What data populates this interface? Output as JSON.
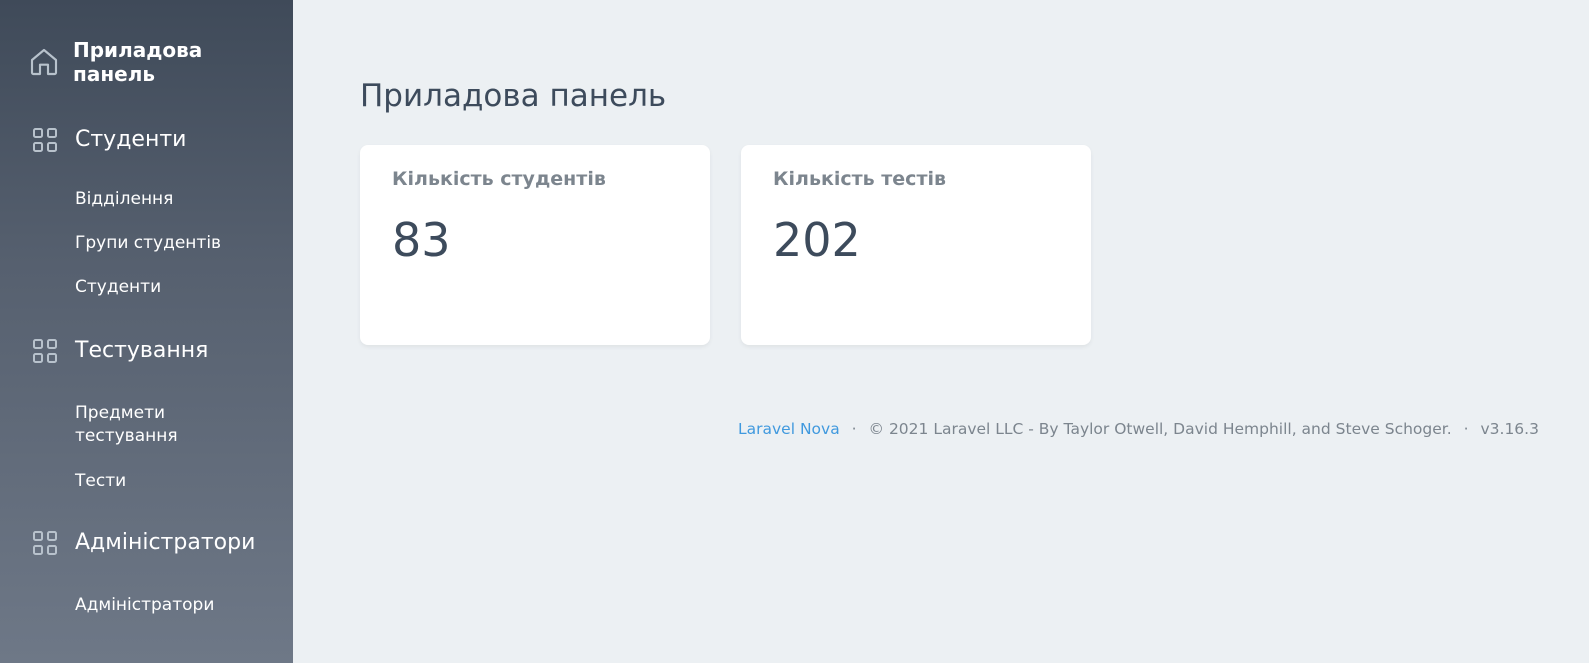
{
  "sidebar": {
    "dashboard": {
      "label": "Приладова панель",
      "icon": "home-icon"
    },
    "groups": [
      {
        "label": "Студенти",
        "icon": "grid-icon",
        "items": [
          "Відділення",
          "Групи студентів",
          "Студенти"
        ]
      },
      {
        "label": "Тестування",
        "icon": "grid-icon",
        "items": [
          "Предмети тестування",
          "Тести"
        ]
      },
      {
        "label": "Адміністратори",
        "icon": "grid-icon",
        "items": [
          "Адміністратори"
        ]
      }
    ]
  },
  "main": {
    "title": "Приладова панель",
    "cards": [
      {
        "title": "Кількість студентів",
        "value": "83"
      },
      {
        "title": "Кількість тестів",
        "value": "202"
      }
    ]
  },
  "footer": {
    "brand": "Laravel Nova",
    "separator": "·",
    "copyright": "© 2021 Laravel LLC - By Taylor Otwell, David Hemphill, and Steve Schoger.",
    "version": "v3.16.3"
  },
  "colors": {
    "sidebar_top": "#3f4a59",
    "sidebar_bottom": "#6e7887",
    "background": "#ecf0f3",
    "link": "#4099de",
    "heading": "#3d4b5c",
    "muted": "#7c858e"
  }
}
